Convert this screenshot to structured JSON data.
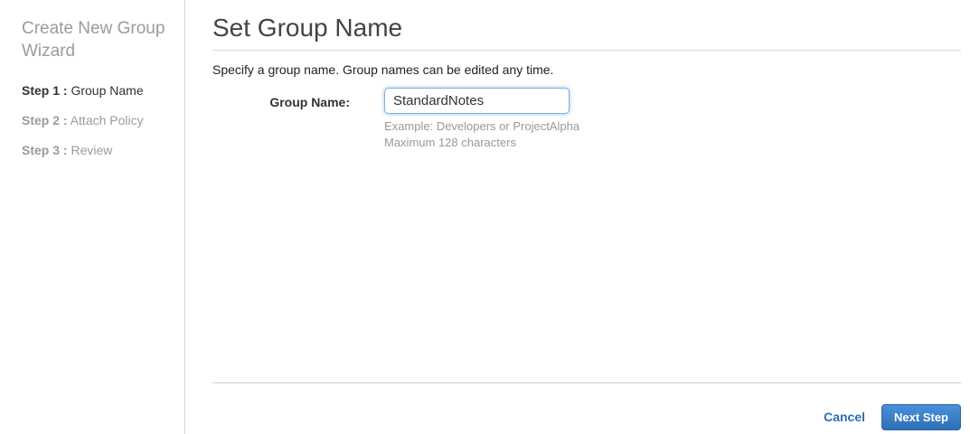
{
  "wizard": {
    "title": "Create New Group Wizard",
    "steps": [
      {
        "prefix": "Step 1 :",
        "label": " Group Name",
        "active": true
      },
      {
        "prefix": "Step 2 :",
        "label": " Attach Policy",
        "active": false
      },
      {
        "prefix": "Step 3 :",
        "label": " Review",
        "active": false
      }
    ]
  },
  "main": {
    "title": "Set Group Name",
    "description": "Specify a group name. Group names can be edited any time.",
    "form": {
      "group_name_label": "Group Name:",
      "group_name_value": "StandardNotes",
      "hint_example": "Example: Developers or ProjectAlpha",
      "hint_max": "Maximum 128 characters"
    }
  },
  "footer": {
    "cancel_label": "Cancel",
    "next_label": "Next Step"
  },
  "colors": {
    "link_blue": "#2b6db4",
    "button_gradient_top": "#4a90d9",
    "button_gradient_bottom": "#2e6fb7",
    "input_focus_border": "#7cb1e2",
    "active_step_text": "#333333",
    "inactive_step_text": "#9b9b9b"
  }
}
